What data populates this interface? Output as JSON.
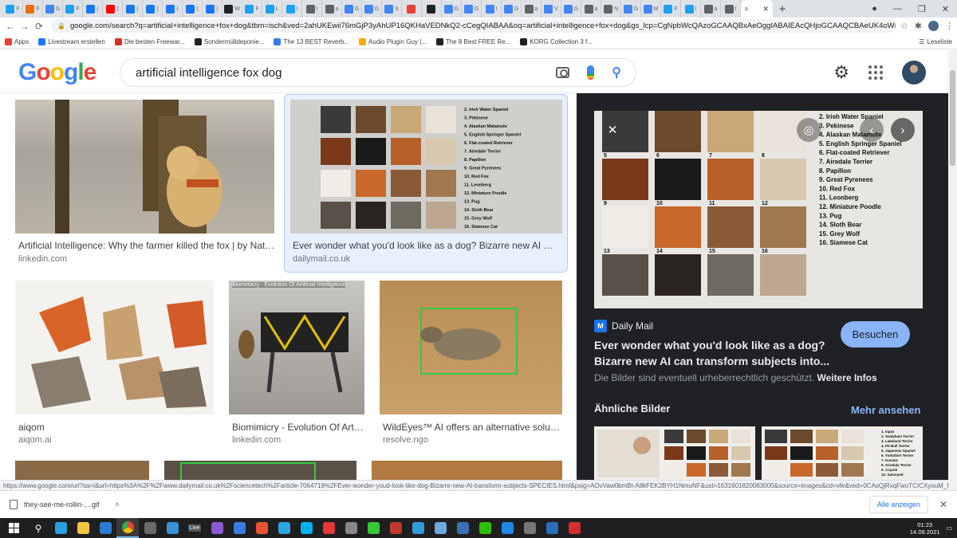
{
  "tabs": {
    "items": [
      {
        "label": "F",
        "icon_color": "#1da1f2"
      },
      {
        "label": "F",
        "icon_color": "#e8710a"
      },
      {
        "label": "G",
        "icon_color": "#4285f4"
      },
      {
        "label": "F",
        "icon_color": "#1da1f2"
      },
      {
        "label": "(",
        "icon_color": "#1877f2"
      },
      {
        "label": "(",
        "icon_color": "#ff0000"
      },
      {
        "label": "(",
        "icon_color": "#1877f2"
      },
      {
        "label": "(",
        "icon_color": "#1877f2"
      },
      {
        "label": "(",
        "icon_color": "#1877f2"
      },
      {
        "label": "(",
        "icon_color": "#1877f2"
      },
      {
        "label": "(",
        "icon_color": "#1877f2"
      },
      {
        "label": "W",
        "icon_color": "#202124"
      },
      {
        "label": "F",
        "icon_color": "#1da1f2"
      },
      {
        "label": "L",
        "icon_color": "#1da1f2"
      },
      {
        "label": "I",
        "icon_color": "#1da1f2"
      },
      {
        "label": "I",
        "icon_color": "#5f6368"
      },
      {
        "label": "a",
        "icon_color": "#5f6368"
      },
      {
        "label": "G",
        "icon_color": "#4285f4"
      },
      {
        "label": "G",
        "icon_color": "#4285f4"
      },
      {
        "label": "S",
        "icon_color": "#4285f4"
      },
      {
        "label": "",
        "icon_color": "#ea4335"
      },
      {
        "label": "",
        "icon_color": "#202124"
      },
      {
        "label": "G",
        "icon_color": "#4285f4"
      },
      {
        "label": "G",
        "icon_color": "#4285f4"
      },
      {
        "label": "I",
        "icon_color": "#4285f4"
      },
      {
        "label": "G",
        "icon_color": "#4285f4"
      },
      {
        "label": "a",
        "icon_color": "#5f6368"
      },
      {
        "label": "V",
        "icon_color": "#4285f4"
      },
      {
        "label": "G",
        "icon_color": "#4285f4"
      },
      {
        "label": "a",
        "icon_color": "#5f6368"
      },
      {
        "label": "N",
        "icon_color": "#5f6368"
      },
      {
        "label": "G",
        "icon_color": "#4285f4"
      },
      {
        "label": "M",
        "icon_color": "#4285f4"
      },
      {
        "label": "F",
        "icon_color": "#1da1f2"
      },
      {
        "label": "I",
        "icon_color": "#1da1f2"
      },
      {
        "label": "a",
        "icon_color": "#5f6368"
      },
      {
        "label": "I",
        "icon_color": "#5f6368"
      }
    ],
    "active_label": "a",
    "new_tab": "+",
    "window_controls": [
      "●",
      "—",
      "❐",
      "✕"
    ]
  },
  "address_bar": {
    "back": "←",
    "forward": "→",
    "reload": "⟳",
    "url": "google.com/search?q=artificial+intelligence+fox+dog&tbm=isch&ved=2ahUKEwii76mGjP3yAhUP16QKHaVEDNkQ2-cCegQIABAA&oq=artificial+intelligence+fox+dog&gs_lcp=CgNpbWcQAzoGCAAQBxAeOggIABAIEAcQHjoGCAAQCBAeUK4oWN0-YKQ_aAB...",
    "star": "☆",
    "extensions": "✱"
  },
  "bookmarks": {
    "items": [
      {
        "label": "Apps",
        "icon_color": "#ea4335"
      },
      {
        "label": "Livestream erstellen",
        "icon_color": "#1877f2"
      },
      {
        "label": "Die besten Freewar...",
        "icon_color": "#d93025"
      },
      {
        "label": "Sondermülldeponie...",
        "icon_color": "#202124"
      },
      {
        "label": "The 13 BEST Reverb...",
        "icon_color": "#3b78e7"
      },
      {
        "label": "Audio Plugin Guy |...",
        "icon_color": "#f9ab00"
      },
      {
        "label": "The 8 Best FREE Re...",
        "icon_color": "#202124"
      },
      {
        "label": "KORG Collection 3 f...",
        "icon_color": "#202124"
      }
    ],
    "reading_list": "Leseliste"
  },
  "header": {
    "logo_letters": [
      "G",
      "o",
      "o",
      "g",
      "l",
      "e"
    ],
    "query": "artificial intelligence fox dog"
  },
  "results": [
    {
      "title": "Artificial Intelligence: Why the farmer killed the fox | by Nata...",
      "source": "linkedin.com"
    },
    {
      "title": "Ever wonder what you'd look like as a dog? Bizarre new AI can ...",
      "source": "dailymail.co.uk"
    },
    {
      "title": "aiqom",
      "source": "aiqom.ai"
    },
    {
      "title": "Biomimicry - Evolution Of Arti...",
      "source": "linkedin.com",
      "overlay": "Biomimicry - Evolution Of Artificial Intelligence"
    },
    {
      "title": "WildEyes™ AI offers an alternative soluti...",
      "source": "resolve.ngo"
    }
  ],
  "panel": {
    "source_logo": "M",
    "source": "Daily Mail",
    "visit_label": "Besuchen",
    "title": "Ever wonder what you'd look like as a dog? Bizarre new AI can transform subjects into...",
    "copyright": "Die Bilder sind eventuell urheberrechtlich geschützt.",
    "more_info": "Weitere Infos",
    "similar_heading": "Ähnliche Bilder",
    "see_more": "Mehr ansehen",
    "breed_list": [
      "2. Irish Water Spaniel",
      "3. Pekinese",
      "4. Alaskan Malamute",
      "5. English Springer Spaniel",
      "6. Flat-coated Retriever",
      "7. Airedale Terrier",
      "8. Papillon",
      "9. Great Pyrenees",
      "10. Red Fox",
      "11. Leonberg",
      "12. Miniature Poodle",
      "13. Pug",
      "14. Sloth Bear",
      "15. Grey Wolf",
      "16. Siamese Cat"
    ],
    "grid_numbers": [
      "5",
      "6",
      "7",
      "8",
      "9",
      "10",
      "11",
      "12",
      "13",
      "14",
      "15",
      "16"
    ],
    "similar_list": [
      "1. Input",
      "2. Sealyham Terrier",
      "3. Lakeland Terrier",
      "4. Pit Bull Terrier",
      "5. Japanese Spaniel",
      "6. Yorkshire Terrier",
      "7. Kuvasz",
      "8. Airedale Terrier",
      "9. Coyote",
      "10. Samoyed"
    ]
  },
  "status_url": "https://www.google.com/url?sa=i&url=https%3A%2F%2Fwww.dailymail.co.uk%2Fsciencetech%2Farticle-7064719%2FEver-wonder-youd-look-like-dog-Bizarre-new-AI-transform-subjects-SPECIES.html&psig=AOvVaw0bmBt-A8kFEK2BYH1NmuNF&ust=1631601820083000&source=images&cd=vfe&ved=0CAsQjRxqFwoTCICXyouM_fICFQAAAAAdAAAAA...",
  "download": {
    "filename": "they-see-me-rollin-....gif",
    "show_all": "Alle anzeigen"
  },
  "taskbar": {
    "time": "01:23",
    "date": "14.09.2021",
    "icons": [
      {
        "name": "search",
        "color": "#ffffff"
      },
      {
        "name": "edge",
        "color": "#2aa0e0"
      },
      {
        "name": "folder",
        "color": "#f4c542"
      },
      {
        "name": "mail",
        "color": "#2b7cd3"
      },
      {
        "name": "chrome",
        "color": "#ea4335"
      },
      {
        "name": "app",
        "color": "#6a6a6a"
      },
      {
        "name": "app",
        "color": "#3a8fd6"
      },
      {
        "name": "live",
        "color": "#555555"
      },
      {
        "name": "app",
        "color": "#8c5ad6"
      },
      {
        "name": "app",
        "color": "#3d7be0"
      },
      {
        "name": "app",
        "color": "#e8542d"
      },
      {
        "name": "telegram",
        "color": "#2ca5e0"
      },
      {
        "name": "skype",
        "color": "#00aff0"
      },
      {
        "name": "app",
        "color": "#e03a3a"
      },
      {
        "name": "app",
        "color": "#888888"
      },
      {
        "name": "app",
        "color": "#37c837"
      },
      {
        "name": "app",
        "color": "#c0392b"
      },
      {
        "name": "app",
        "color": "#2f9ed8"
      },
      {
        "name": "app",
        "color": "#6fa8dc"
      },
      {
        "name": "app",
        "color": "#3b6fb6"
      },
      {
        "name": "wechat",
        "color": "#2dc100"
      },
      {
        "name": "app",
        "color": "#1e88e5"
      },
      {
        "name": "app",
        "color": "#777777"
      },
      {
        "name": "app",
        "color": "#2a6ebb"
      },
      {
        "name": "app",
        "color": "#d32f2f"
      }
    ],
    "live_label": "Live"
  },
  "colors": {
    "accent": "#1a73e8",
    "panel_bg": "#202124",
    "link_dark": "#8ab4f8"
  }
}
